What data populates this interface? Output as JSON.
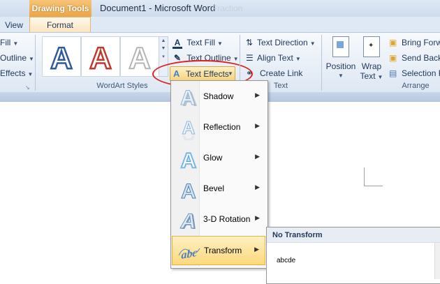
{
  "titlebar": {
    "contextual_tab_group": "Drawing Tools",
    "document_title": "Document1  -  Microsoft Word",
    "faint_text": "Fraction"
  },
  "tabs": {
    "view": "View",
    "format": "Format"
  },
  "ribbon": {
    "left_partial": {
      "fill": "Fill",
      "outline": "Outline",
      "effects": "Effects"
    },
    "wordart": {
      "group_label": "WordArt Styles",
      "tiles": [
        "A",
        "A",
        "A"
      ],
      "text_fill": "Text Fill",
      "text_outline": "Text Outline",
      "text_effects": "Text Effects"
    },
    "text_group": {
      "group_label": "Text",
      "text_direction": "Text Direction",
      "align_text": "Align Text",
      "create_link": "Create Link"
    },
    "arrange": {
      "group_label": "Arrange",
      "position": "Position",
      "wrap_text_line1": "Wrap",
      "wrap_text_line2": "Text",
      "bring_forward": "Bring Forw",
      "send_backward": "Send Back",
      "selection_pane": "Selection P"
    }
  },
  "text_effects_menu": {
    "items": [
      {
        "label": "Shadow",
        "icon": "shadow-a-icon"
      },
      {
        "label": "Reflection",
        "icon": "reflection-a-icon"
      },
      {
        "label": "Glow",
        "icon": "glow-a-icon"
      },
      {
        "label": "Bevel",
        "icon": "bevel-a-icon"
      },
      {
        "label": "3-D Rotation",
        "icon": "3d-rotation-a-icon"
      },
      {
        "label": "Transform",
        "icon": "transform-abc-icon",
        "highlighted": true
      }
    ]
  },
  "transform_submenu": {
    "header": "No Transform",
    "sample": "abcde"
  },
  "colors": {
    "ribbon_bg": "#dde7f3",
    "contextual_tab": "#eaa64a",
    "highlight_circle": "#e01f1f",
    "menu_highlight": "#fcd97b"
  }
}
